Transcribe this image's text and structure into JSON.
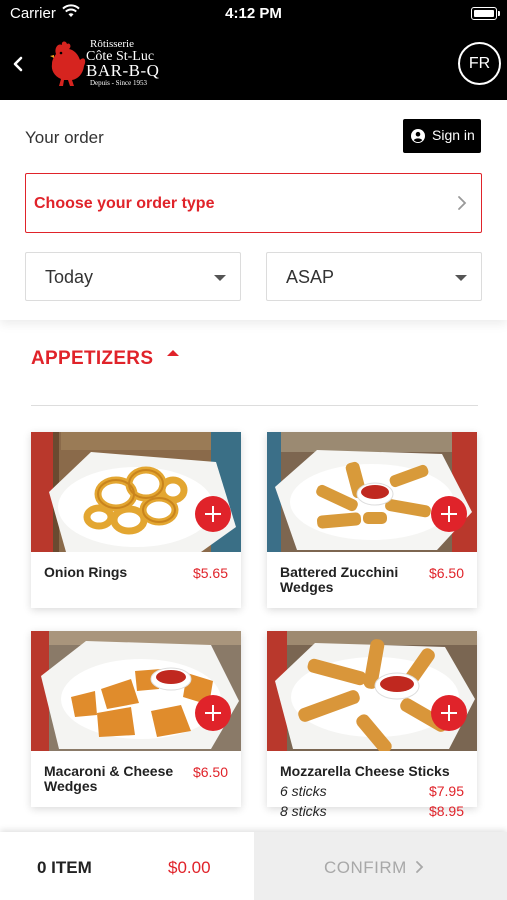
{
  "status_bar": {
    "carrier": "Carrier",
    "time": "4:12 PM"
  },
  "header": {
    "logo": {
      "line1": "Rôtisserie",
      "line2": "Côte St-Luc",
      "line3": "BAR-B-Q",
      "line4": "Depuis - Since 1953"
    },
    "language_button": "FR"
  },
  "order": {
    "title": "Your order",
    "sign_in_label": "Sign in",
    "order_type_label": "Choose your order type",
    "day_value": "Today",
    "time_value": "ASAP"
  },
  "section": {
    "title": "APPETIZERS"
  },
  "menu": [
    {
      "name": "Onion Rings",
      "price": "$5.65"
    },
    {
      "name": "Battered Zucchini Wedges",
      "price": "$6.50"
    },
    {
      "name": "Macaroni & Cheese Wedges",
      "price": "$6.50"
    },
    {
      "name": "Mozzarella Cheese Sticks",
      "options": [
        {
          "label": "6 sticks",
          "price": "$7.95"
        },
        {
          "label": "8 sticks",
          "price": "$8.95"
        }
      ]
    }
  ],
  "cart": {
    "items_label": "0 ITEM",
    "total": "$0.00",
    "confirm_label": "CONFIRM"
  },
  "colors": {
    "accent": "#e0232a",
    "header_bg": "#000000",
    "confirm_bg": "#eeeeee"
  }
}
